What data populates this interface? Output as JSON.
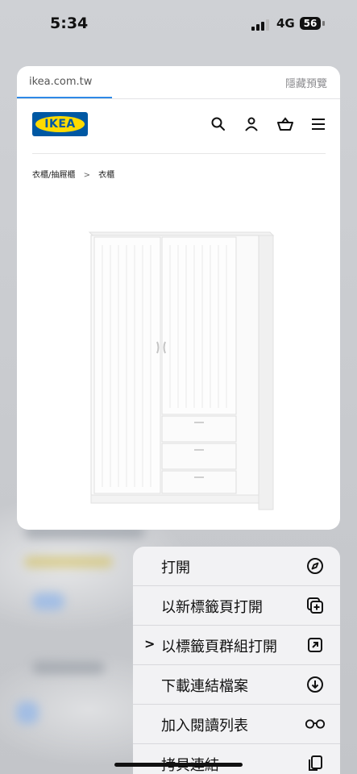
{
  "status_bar": {
    "time": "5:34",
    "network": "4G",
    "battery": "56"
  },
  "preview": {
    "url": "ikea.com.tw",
    "hide_label": "隱藏預覽",
    "logo_text": "IKEA",
    "breadcrumb": {
      "parent": "衣櫃/抽屜櫃",
      "separator": ">",
      "current": "衣櫃"
    },
    "nav_icons": [
      "search-icon",
      "account-icon",
      "cart-icon",
      "menu-icon"
    ],
    "product": "white wardrobe"
  },
  "menu": {
    "items": [
      {
        "label": "打開",
        "icon": "compass-icon",
        "chevron": ""
      },
      {
        "label": "以新標籤頁打開",
        "icon": "new-tab-icon",
        "chevron": ""
      },
      {
        "label": "以標籤頁群組打開",
        "icon": "open-external-icon",
        "chevron": ">"
      },
      {
        "label": "下載連結檔案",
        "icon": "download-icon",
        "chevron": ""
      },
      {
        "label": "加入閱讀列表",
        "icon": "reading-list-icon",
        "chevron": ""
      },
      {
        "label": "拷貝連結",
        "icon": "copy-icon",
        "chevron": ""
      }
    ]
  },
  "colors": {
    "accent_blue": "#2e88e6",
    "ikea_blue": "#0058a3",
    "ikea_yellow": "#ffdb00"
  }
}
